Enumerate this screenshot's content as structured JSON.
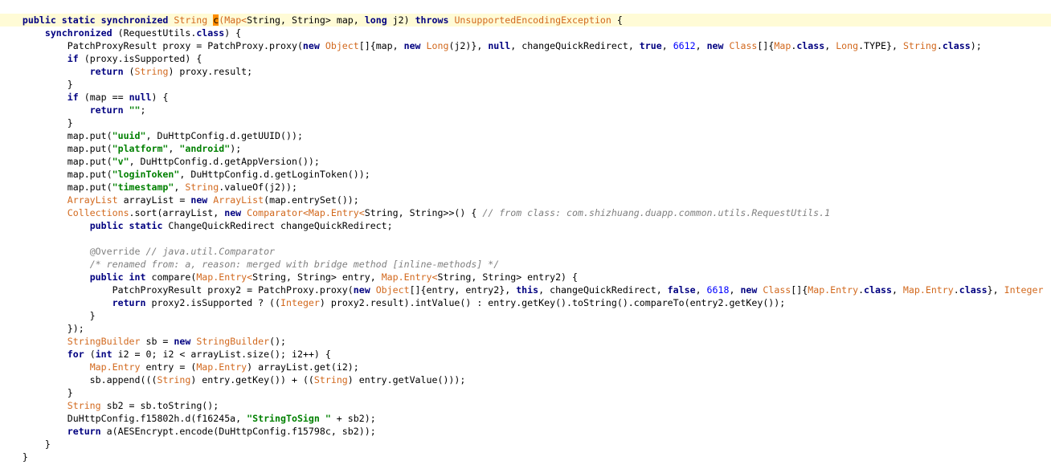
{
  "editor": {
    "cursor_line": 0,
    "styles": {
      "p": "plain",
      "kw": "keyword",
      "ty": "type",
      "st": "string",
      "cm": "comment",
      "an": "annotation",
      "nm": "number",
      "caret": "caret-highlight"
    },
    "colors": {
      "keyword": "#000080",
      "type": "#d2691e",
      "string": "#008000",
      "comment": "#808080",
      "number": "#0000ff",
      "current_line": "#fffbd6",
      "caret": "#ff8c00"
    },
    "lines": [
      [
        [
          "p",
          "    "
        ],
        [
          "kw",
          "public static synchronized"
        ],
        [
          "p",
          " "
        ],
        [
          "ty",
          "String"
        ],
        [
          "p",
          " "
        ],
        [
          "caret",
          "c"
        ],
        [
          "ty",
          "(Map<"
        ],
        [
          "p",
          "String, String> map, "
        ],
        [
          "kw",
          "long"
        ],
        [
          "p",
          " j2) "
        ],
        [
          "kw",
          "throws"
        ],
        [
          "p",
          " "
        ],
        [
          "ty",
          "UnsupportedEncodingException"
        ],
        [
          "p",
          " {"
        ]
      ],
      [
        [
          "p",
          "        "
        ],
        [
          "kw",
          "synchronized"
        ],
        [
          "p",
          " (RequestUtils."
        ],
        [
          "kw",
          "class"
        ],
        [
          "p",
          ") {"
        ]
      ],
      [
        [
          "p",
          "            PatchProxyResult proxy = PatchProxy.proxy("
        ],
        [
          "kw",
          "new"
        ],
        [
          "p",
          " "
        ],
        [
          "ty",
          "Object"
        ],
        [
          "p",
          "[]{map, "
        ],
        [
          "kw",
          "new"
        ],
        [
          "p",
          " "
        ],
        [
          "ty",
          "Long"
        ],
        [
          "p",
          "(j2)}, "
        ],
        [
          "kw",
          "null"
        ],
        [
          "p",
          ", changeQuickRedirect, "
        ],
        [
          "kw",
          "true"
        ],
        [
          "p",
          ", "
        ],
        [
          "nm",
          "6612"
        ],
        [
          "p",
          ", "
        ],
        [
          "kw",
          "new"
        ],
        [
          "p",
          " "
        ],
        [
          "ty",
          "Class"
        ],
        [
          "p",
          "[]{"
        ],
        [
          "ty",
          "Map"
        ],
        [
          "p",
          "."
        ],
        [
          "kw",
          "class"
        ],
        [
          "p",
          ", "
        ],
        [
          "ty",
          "Long"
        ],
        [
          "p",
          ".TYPE}, "
        ],
        [
          "ty",
          "String"
        ],
        [
          "p",
          "."
        ],
        [
          "kw",
          "class"
        ],
        [
          "p",
          ");"
        ]
      ],
      [
        [
          "p",
          "            "
        ],
        [
          "kw",
          "if"
        ],
        [
          "p",
          " (proxy.isSupported) {"
        ]
      ],
      [
        [
          "p",
          "                "
        ],
        [
          "kw",
          "return"
        ],
        [
          "p",
          " ("
        ],
        [
          "ty",
          "String"
        ],
        [
          "p",
          ") proxy.result;"
        ]
      ],
      [
        [
          "p",
          "            }"
        ]
      ],
      [
        [
          "p",
          "            "
        ],
        [
          "kw",
          "if"
        ],
        [
          "p",
          " (map == "
        ],
        [
          "kw",
          "null"
        ],
        [
          "p",
          ") {"
        ]
      ],
      [
        [
          "p",
          "                "
        ],
        [
          "kw",
          "return"
        ],
        [
          "p",
          " "
        ],
        [
          "st",
          "\"\""
        ],
        [
          "p",
          ";"
        ]
      ],
      [
        [
          "p",
          "            }"
        ]
      ],
      [
        [
          "p",
          "            map.put("
        ],
        [
          "st",
          "\"uuid\""
        ],
        [
          "p",
          ", DuHttpConfig.d.getUUID());"
        ]
      ],
      [
        [
          "p",
          "            map.put("
        ],
        [
          "st",
          "\"platform\""
        ],
        [
          "p",
          ", "
        ],
        [
          "st",
          "\"android\""
        ],
        [
          "p",
          ");"
        ]
      ],
      [
        [
          "p",
          "            map.put("
        ],
        [
          "st",
          "\"v\""
        ],
        [
          "p",
          ", DuHttpConfig.d.getAppVersion());"
        ]
      ],
      [
        [
          "p",
          "            map.put("
        ],
        [
          "st",
          "\"loginToken\""
        ],
        [
          "p",
          ", DuHttpConfig.d.getLoginToken());"
        ]
      ],
      [
        [
          "p",
          "            map.put("
        ],
        [
          "st",
          "\"timestamp\""
        ],
        [
          "p",
          ", "
        ],
        [
          "ty",
          "String"
        ],
        [
          "p",
          ".valueOf(j2));"
        ]
      ],
      [
        [
          "p",
          "            "
        ],
        [
          "ty",
          "ArrayList"
        ],
        [
          "p",
          " arrayList = "
        ],
        [
          "kw",
          "new"
        ],
        [
          "p",
          " "
        ],
        [
          "ty",
          "ArrayList"
        ],
        [
          "p",
          "(map.entrySet());"
        ]
      ],
      [
        [
          "p",
          "            "
        ],
        [
          "ty",
          "Collections"
        ],
        [
          "p",
          ".sort(arrayList, "
        ],
        [
          "kw",
          "new"
        ],
        [
          "p",
          " "
        ],
        [
          "ty",
          "Comparator<Map.Entry<"
        ],
        [
          "p",
          "String, String>>() { "
        ],
        [
          "cm",
          "// from class: com.shizhuang.duapp.common.utils.RequestUtils.1"
        ]
      ],
      [
        [
          "p",
          "                "
        ],
        [
          "kw",
          "public static"
        ],
        [
          "p",
          " ChangeQuickRedirect changeQuickRedirect;"
        ]
      ],
      [
        [
          "p",
          ""
        ]
      ],
      [
        [
          "p",
          "                "
        ],
        [
          "an",
          "@Override"
        ],
        [
          "p",
          " "
        ],
        [
          "cm",
          "// java.util.Comparator"
        ]
      ],
      [
        [
          "p",
          "                "
        ],
        [
          "cm",
          "/* renamed from: a, reason: merged with bridge method [inline-methods] */"
        ]
      ],
      [
        [
          "p",
          "                "
        ],
        [
          "kw",
          "public int"
        ],
        [
          "p",
          " compare("
        ],
        [
          "ty",
          "Map.Entry<"
        ],
        [
          "p",
          "String, String> entry, "
        ],
        [
          "ty",
          "Map.Entry<"
        ],
        [
          "p",
          "String, String> entry2) {"
        ]
      ],
      [
        [
          "p",
          "                    PatchProxyResult proxy2 = PatchProxy.proxy("
        ],
        [
          "kw",
          "new"
        ],
        [
          "p",
          " "
        ],
        [
          "ty",
          "Object"
        ],
        [
          "p",
          "[]{entry, entry2}, "
        ],
        [
          "kw",
          "this"
        ],
        [
          "p",
          ", changeQuickRedirect, "
        ],
        [
          "kw",
          "false"
        ],
        [
          "p",
          ", "
        ],
        [
          "nm",
          "6618"
        ],
        [
          "p",
          ", "
        ],
        [
          "kw",
          "new"
        ],
        [
          "p",
          " "
        ],
        [
          "ty",
          "Class"
        ],
        [
          "p",
          "[]{"
        ],
        [
          "ty",
          "Map.Entry"
        ],
        [
          "p",
          "."
        ],
        [
          "kw",
          "class"
        ],
        [
          "p",
          ", "
        ],
        [
          "ty",
          "Map.Entry"
        ],
        [
          "p",
          "."
        ],
        [
          "kw",
          "class"
        ],
        [
          "p",
          "}, "
        ],
        [
          "ty",
          "Integer"
        ]
      ],
      [
        [
          "p",
          "                    "
        ],
        [
          "kw",
          "return"
        ],
        [
          "p",
          " proxy2.isSupported ? (("
        ],
        [
          "ty",
          "Integer"
        ],
        [
          "p",
          ") proxy2.result).intValue() : entry.getKey().toString().compareTo(entry2.getKey());"
        ]
      ],
      [
        [
          "p",
          "                }"
        ]
      ],
      [
        [
          "p",
          "            });"
        ]
      ],
      [
        [
          "p",
          "            "
        ],
        [
          "ty",
          "StringBuilder"
        ],
        [
          "p",
          " sb = "
        ],
        [
          "kw",
          "new"
        ],
        [
          "p",
          " "
        ],
        [
          "ty",
          "StringBuilder"
        ],
        [
          "p",
          "();"
        ]
      ],
      [
        [
          "p",
          "            "
        ],
        [
          "kw",
          "for"
        ],
        [
          "p",
          " ("
        ],
        [
          "kw",
          "int"
        ],
        [
          "p",
          " i2 = 0; i2 < arrayList.size(); i2++) {"
        ]
      ],
      [
        [
          "p",
          "                "
        ],
        [
          "ty",
          "Map.Entry"
        ],
        [
          "p",
          " entry = ("
        ],
        [
          "ty",
          "Map.Entry"
        ],
        [
          "p",
          ") arrayList.get(i2);"
        ]
      ],
      [
        [
          "p",
          "                sb.append((("
        ],
        [
          "ty",
          "String"
        ],
        [
          "p",
          ") entry.getKey()) + (("
        ],
        [
          "ty",
          "String"
        ],
        [
          "p",
          ") entry.getValue()));"
        ]
      ],
      [
        [
          "p",
          "            }"
        ]
      ],
      [
        [
          "p",
          "            "
        ],
        [
          "ty",
          "String"
        ],
        [
          "p",
          " sb2 = sb.toString();"
        ]
      ],
      [
        [
          "p",
          "            DuHttpConfig.f15802h.d(f16245a, "
        ],
        [
          "st",
          "\"StringToSign \""
        ],
        [
          "p",
          " + sb2);"
        ]
      ],
      [
        [
          "p",
          "            "
        ],
        [
          "kw",
          "return"
        ],
        [
          "p",
          " a(AESEncrypt.encode(DuHttpConfig.f15798c, sb2));"
        ]
      ],
      [
        [
          "p",
          "        }"
        ]
      ],
      [
        [
          "p",
          "    }"
        ]
      ]
    ]
  }
}
